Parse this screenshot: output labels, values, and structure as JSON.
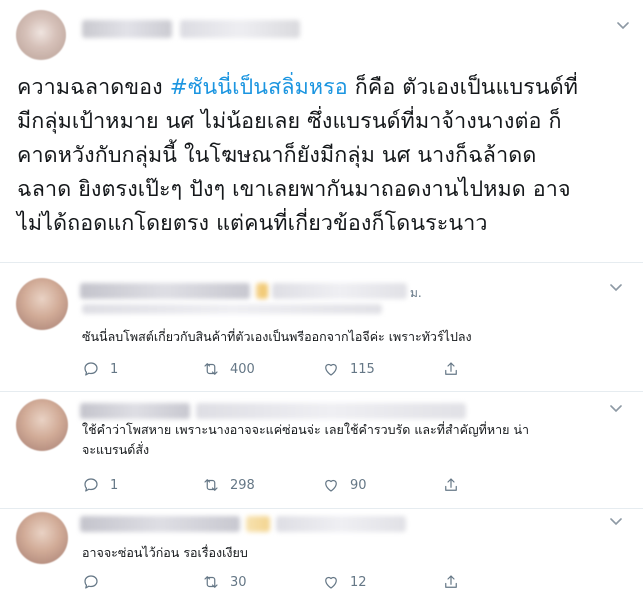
{
  "main_tweet": {
    "text_prefix": "ความฉลาดของ ",
    "hashtag": "#ซันนี่เป็นสลิ่มหรอ",
    "text_lines": [
      " ก็คือ ตัวเองเป็นแบรนด์ที่",
      "มีกลุ่มเป้าหมาย นศ ไม่น้อยเลย ซึ่งแบรนด์ที่มาจ้างนางต่อ ก็",
      "คาดหวังกับกลุ่มนี้ ในโฆษณาก็ยังมีกลุ่ม นศ นางก็ฉล้าดด",
      "ฉลาด ยิงตรงเป๊ะๆ ปังๆ เขาเลยพากันมาถอดงานไปหมด อาจ",
      "ไม่ได้ถอดแกโดยตรง แต่คนที่เกี่ยวข้องก็โดนระนาว"
    ]
  },
  "replies": [
    {
      "name_suffix": "ม.",
      "text": "ซันนี่ลบโพสต์เกี่ยวกับสินค้าที่ตัวเองเป็นพรีออกจากไอจีค่ะ เพราะทัวร์ไปลง",
      "reply_count": "1",
      "retweet_count": "400",
      "like_count": "115"
    },
    {
      "name_suffix": "",
      "text_lines": [
        "ใช้คำว่าโพสหาย เพราะนางอาจจะแค่ซ่อนจ่ะ เลยใช้คำรวบรัด และที่สำคัญที่หาย น่า",
        "จะแบรนด์สั่ง"
      ],
      "reply_count": "1",
      "retweet_count": "298",
      "like_count": "90"
    },
    {
      "name_suffix": "",
      "text": "อาจจะซ่อนไว้ก่อน รอเรื่องเงียบ",
      "reply_count": "",
      "retweet_count": "30",
      "like_count": "12"
    }
  ],
  "icons": {
    "more": "chevron-down-icon",
    "reply": "reply-icon",
    "retweet": "retweet-icon",
    "like": "heart-icon",
    "share": "share-icon"
  },
  "colors": {
    "hashtag": "#1b95e0",
    "text": "#14171a",
    "secondary": "#657786",
    "divider": "#e6ecf0"
  }
}
